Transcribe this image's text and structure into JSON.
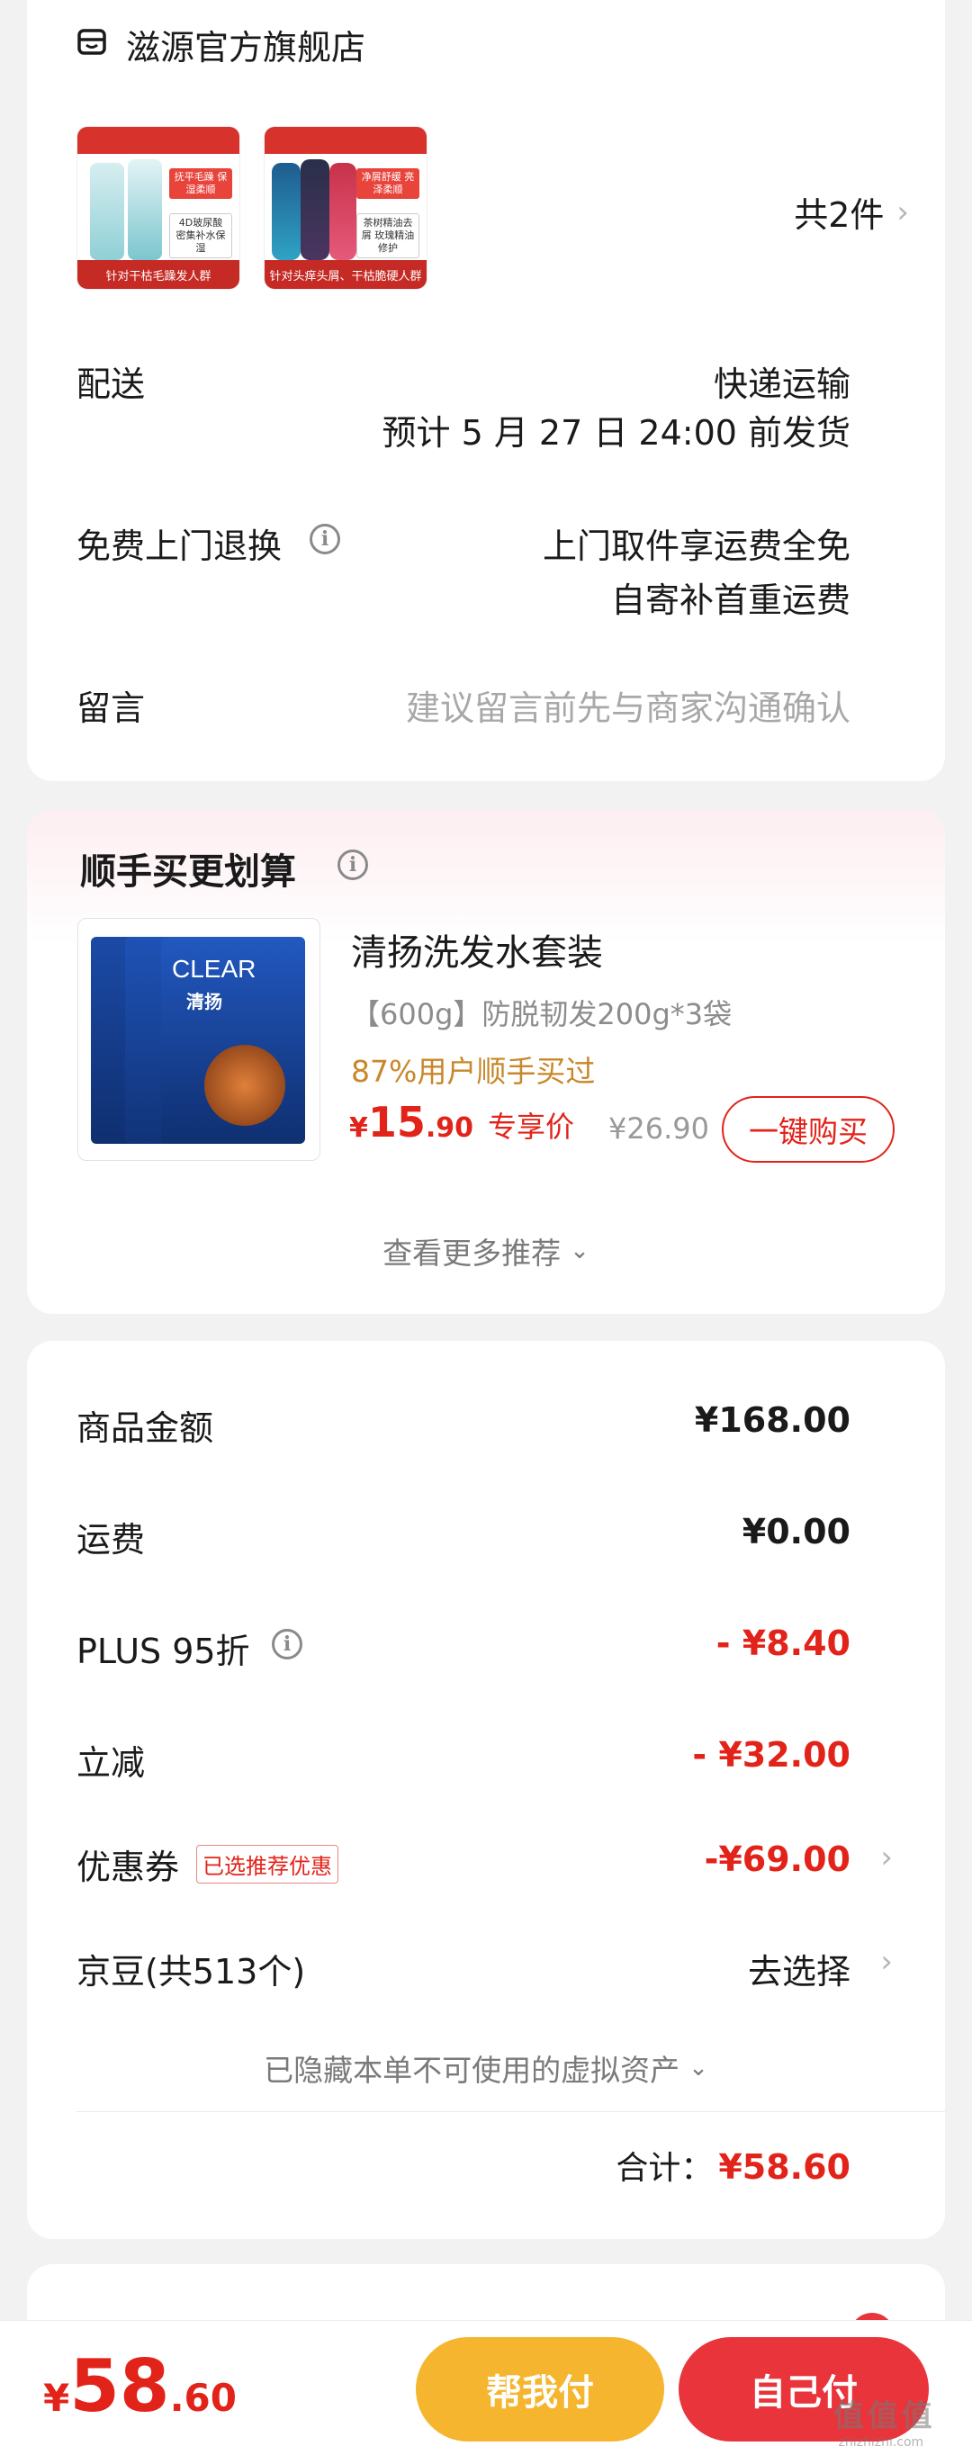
{
  "store": {
    "name": "滋源官方旗舰店",
    "item_count": "共2件",
    "products": [
      {
        "banner": "针对干枯毛躁发人群",
        "tag1": "抚平毛躁 保湿柔顺",
        "tag2": "4D玻尿酸 密集补水保湿"
      },
      {
        "banner": "针对头痒头屑、干枯脆硬人群",
        "tag1": "净屑舒缓 亮泽柔顺",
        "tag2": "茶树精油去屑 玫瑰精油修护"
      }
    ]
  },
  "delivery": {
    "label": "配送",
    "method": "快递运输",
    "estimate": "预计 5 月 27 日 24:00 前发货"
  },
  "returns": {
    "label": "免费上门退换",
    "line1": "上门取件享运费全免",
    "line2": "自寄补首重运费"
  },
  "message": {
    "label": "留言",
    "placeholder": "建议留言前先与商家沟通确认"
  },
  "upsell": {
    "title": "顺手买更划算",
    "product_name": "清扬洗发水套装",
    "spec": "【600g】防脱韧发200g*3袋",
    "social_proof": "87%用户顺手买过",
    "price_symbol": "¥",
    "price_int": "15",
    "price_dec": ".90",
    "price_note": "专享价",
    "original_price": "¥26.90",
    "buy_button": "一键购买",
    "more": "查看更多推荐",
    "image_brand": "CLEAR",
    "image_sub": "清扬"
  },
  "summary": {
    "rows": [
      {
        "label": "商品金额",
        "value": "¥168.00"
      },
      {
        "label": "运费",
        "value": "¥0.00"
      },
      {
        "label": "PLUS 95折",
        "value": "- ¥8.40"
      },
      {
        "label": "立减",
        "value": "- ¥32.00"
      },
      {
        "label": "优惠券",
        "badge": "已选推荐优惠",
        "value": "-¥69.00"
      },
      {
        "label": "京豆(共513个)",
        "value": "去选择"
      }
    ],
    "hidden_assets": "已隐藏本单不可使用的虚拟资产",
    "total_label": "合计：",
    "total_value": "¥58.60"
  },
  "footer": {
    "price_symbol": "¥",
    "price_int": "58",
    "price_dec": ".60",
    "help_pay": "帮我付",
    "self_pay": "自己付",
    "watermark": "值 值 值",
    "watermark_url": "zhizhizhi.com"
  },
  "colors": {
    "accent_red": "#e2231a",
    "gold": "#c8872a",
    "help_pay_bg": "#f5b52e",
    "self_pay_bg": "#e8343a"
  }
}
